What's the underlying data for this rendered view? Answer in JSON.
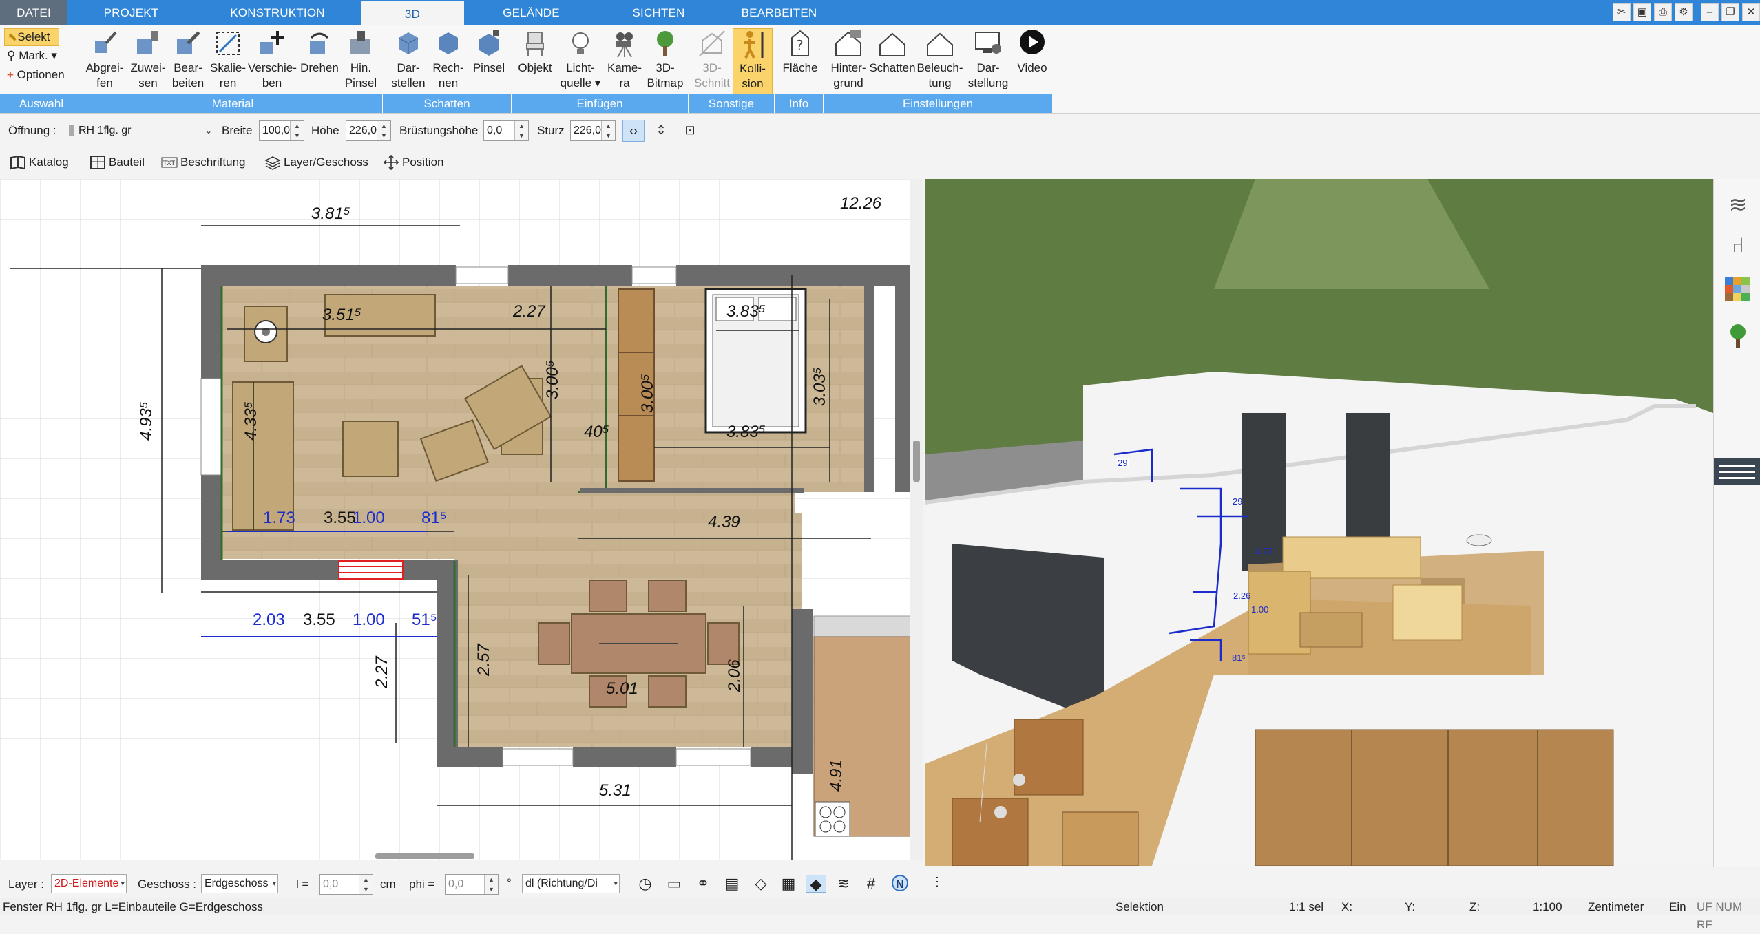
{
  "menu": {
    "tabs": [
      "DATEI",
      "PROJEKT",
      "KONSTRUKTION",
      "3D",
      "GELÄNDE",
      "SICHTEN",
      "BEARBEITEN"
    ],
    "active_tab": "3D"
  },
  "ribbon": {
    "auswahl": {
      "selekt": "Selekt",
      "mark": "Mark.",
      "optionen": "Optionen",
      "group": "Auswahl"
    },
    "material": {
      "group": "Material",
      "buttons": [
        {
          "l1": "Abgrei-",
          "l2": "fen"
        },
        {
          "l1": "Zuwei-",
          "l2": "sen"
        },
        {
          "l1": "Bear-",
          "l2": "beiten"
        },
        {
          "l1": "Skalie-",
          "l2": "ren"
        },
        {
          "l1": "Verschie-",
          "l2": "ben"
        },
        {
          "l1": "Drehen",
          "l2": ""
        },
        {
          "l1": "Hin.",
          "l2": "Pinsel"
        }
      ]
    },
    "schatten": {
      "group": "Schatten",
      "buttons": [
        {
          "l1": "Dar-",
          "l2": "stellen"
        },
        {
          "l1": "Rech-",
          "l2": "nen"
        },
        {
          "l1": "Pinsel",
          "l2": ""
        }
      ]
    },
    "einfuegen": {
      "group": "Einfügen",
      "buttons": [
        {
          "l1": "Objekt",
          "l2": ""
        },
        {
          "l1": "Licht-",
          "l2": "quelle ▾"
        },
        {
          "l1": "Kame-",
          "l2": "ra"
        },
        {
          "l1": "3D-",
          "l2": "Bitmap"
        }
      ]
    },
    "sonstige": {
      "group": "Sonstige",
      "buttons": [
        {
          "l1": "3D-",
          "l2": "Schnitt"
        },
        {
          "l1": "Kolli-",
          "l2": "sion"
        }
      ]
    },
    "info": {
      "group": "Info",
      "buttons": [
        {
          "l1": "Fläche",
          "l2": ""
        }
      ]
    },
    "einstellungen": {
      "group": "Einstellungen",
      "buttons": [
        {
          "l1": "Hinter-",
          "l2": "grund"
        },
        {
          "l1": "Schatten",
          "l2": ""
        },
        {
          "l1": "Beleuch-",
          "l2": "tung"
        },
        {
          "l1": "Dar-",
          "l2": "stellung"
        },
        {
          "l1": "Video",
          "l2": ""
        }
      ]
    }
  },
  "propbar": {
    "oeffnung_label": "Öffnung :",
    "oeffnung_value": "RH 1flg. gr",
    "breite_label": "Breite",
    "breite_value": "100,0",
    "hoehe_label": "Höhe",
    "hoehe_value": "226,0",
    "bruestung_label": "Brüstungshöhe",
    "bruestung_value": "0,0",
    "sturz_label": "Sturz",
    "sturz_value": "226,0"
  },
  "toolbar2": {
    "katalog": "Katalog",
    "bauteil": "Bauteil",
    "beschriftung": "Beschriftung",
    "layer": "Layer/Geschoss",
    "position": "Position"
  },
  "plan": {
    "dims": {
      "top_width": "3.81⁵",
      "top_right": "12.26",
      "left_height": "4.93⁵",
      "room1_width": "3.51⁵",
      "room1_depth": "4.33⁵",
      "living_width": "2.27",
      "closet_h": "3.00⁵",
      "wall_40": "40⁵",
      "bed_width_top": "3.83⁵",
      "bed_width_bottom": "3.83⁵",
      "bed_height": "3.03⁵",
      "kitchen_width": "4.39",
      "door_h": "3.00⁵",
      "dining_depth": "2.57",
      "dining_width": "5.01",
      "right_h": "2.06",
      "bottom_width": "5.31",
      "small_h": "4.91",
      "open_h": "2.27",
      "win_173": "1.73",
      "win_355": "3.55",
      "win_100": "1.00",
      "win_81": "81⁵",
      "b_203": "2.03",
      "b_355": "3.55",
      "b_100": "1.00",
      "b_51": "51⁵"
    }
  },
  "view3d": {
    "labels": [
      "29",
      "29",
      "1.73",
      "2.26",
      "1.00",
      "81⁵"
    ]
  },
  "bottombar": {
    "layer_label": "Layer :",
    "layer_value": "2D-Elemente",
    "geschoss_label": "Geschoss :",
    "geschoss_value": "Erdgeschoss",
    "l_label": "l =",
    "l_value": "0,0",
    "l_unit": "cm",
    "phi_label": "phi =",
    "phi_value": "0,0",
    "phi_unit": "°",
    "dir_value": "dl (Richtung/Di"
  },
  "status": {
    "text": "Fenster RH 1flg. gr L=Einbauteile G=Erdgeschoss",
    "selektion": "Selektion",
    "scale_sel": "1:1 sel",
    "x": "X:",
    "y": "Y:",
    "z": "Z:",
    "scale": "1:100",
    "unit": "Zentimeter",
    "mode": "Ein",
    "flags": "UF NUM RF"
  },
  "colors": {
    "menubar": "#2f86d9",
    "group_label": "#5aa9ee",
    "selected_button": "#fbd36b",
    "wall": "#6b6b6b",
    "floor": "#c9b594",
    "grass": "#6f8a4e",
    "dimension_blue": "#1b2bcc",
    "window_red": "#e02020"
  }
}
